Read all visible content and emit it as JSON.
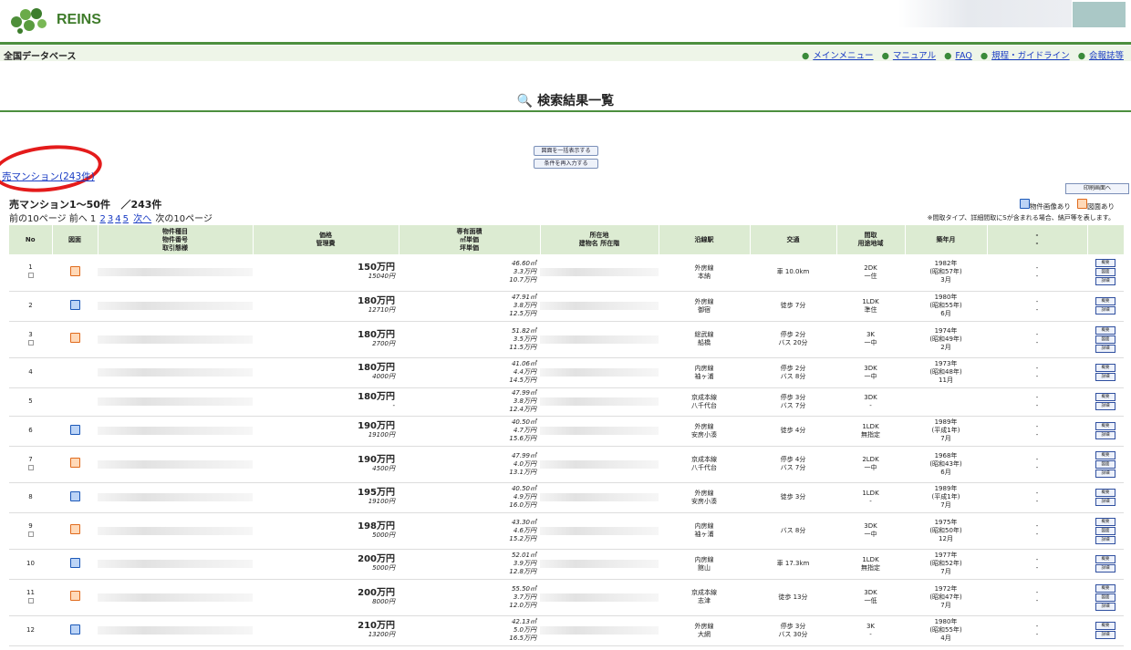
{
  "app": {
    "name": "REINS"
  },
  "nav": {
    "title": "全国データベース",
    "links": [
      "メインメニュー",
      "マニュアル",
      "FAQ",
      "規程・ガイドライン",
      "会報誌等"
    ]
  },
  "page_title": "検索結果一覧",
  "buttons": {
    "zumen_batch": "図面を一括表示する",
    "re_enter": "条件を再入力する",
    "print": "印刷画面へ"
  },
  "category_link": "売マンション(243件)",
  "count_line": {
    "range": "売マンション1～50件",
    "total": "／243件"
  },
  "pager": {
    "prev10": "前の10ページ",
    "prev": "前へ",
    "current": "1",
    "pages": [
      "2",
      "3",
      "4",
      "5"
    ],
    "next": "次へ",
    "next10": "次の10ページ"
  },
  "legend": {
    "photo": "物件画像あり",
    "drawing": "図面あり"
  },
  "note": "※間取タイプ、詳細間取にSが含まれる場合、納戸等を表します。",
  "table": {
    "headers": {
      "no": "No",
      "zumen": "図面",
      "item": [
        "物件種目",
        "物件番号",
        "取引態様"
      ],
      "price": [
        "価格",
        "管理費"
      ],
      "area": [
        "専有面積",
        "㎡単価",
        "坪単価"
      ],
      "loc": [
        "所在地",
        "建物名 所在階"
      ],
      "line": "沿線駅",
      "transit": "交通",
      "layout": [
        "間取",
        "用途地域"
      ],
      "built": "築年月",
      "extra": [
        "-",
        "-"
      ]
    },
    "row_buttons": {
      "detail": "概要",
      "zumen": "図面",
      "more": "詳細"
    },
    "rows": [
      {
        "no": "1",
        "cb": true,
        "icon": "orange",
        "price": "150万円",
        "fee": "15040円",
        "area": "46.60㎡",
        "sqm": "3.3万円",
        "tsubo": "10.7万円",
        "line": "外房線",
        "station": "本納",
        "t1": "車 10.0km",
        "t2": "",
        "layout": "2DK",
        "zone": "一住",
        "y1": "1982年",
        "y2": "(昭和57年)",
        "y3": "3月",
        "btns": [
          "detail",
          "zumen",
          "more"
        ]
      },
      {
        "no": "2",
        "cb": false,
        "icon": "blue",
        "price": "180万円",
        "fee": "12710円",
        "area": "47.91㎡",
        "sqm": "3.8万円",
        "tsubo": "12.5万円",
        "line": "外房線",
        "station": "御宿",
        "t1": "徒歩 7分",
        "t2": "",
        "layout": "1LDK",
        "zone": "準住",
        "y1": "1980年",
        "y2": "(昭和55年)",
        "y3": "6月",
        "btns": [
          "detail",
          "more"
        ]
      },
      {
        "no": "3",
        "cb": true,
        "icon": "orange",
        "price": "180万円",
        "fee": "2700円",
        "area": "51.82㎡",
        "sqm": "3.5万円",
        "tsubo": "11.5万円",
        "line": "総武線",
        "station": "船橋",
        "t1": "停歩 2分",
        "t2": "バス 20分",
        "layout": "3K",
        "zone": "一中",
        "y1": "1974年",
        "y2": "(昭和49年)",
        "y3": "2月",
        "btns": [
          "detail",
          "zumen",
          "more"
        ]
      },
      {
        "no": "4",
        "cb": false,
        "icon": "",
        "price": "180万円",
        "fee": "4000円",
        "area": "41.06㎡",
        "sqm": "4.4万円",
        "tsubo": "14.5万円",
        "line": "内房線",
        "station": "袖ヶ浦",
        "t1": "停歩 2分",
        "t2": "バス 8分",
        "layout": "3DK",
        "zone": "一中",
        "y1": "1973年",
        "y2": "(昭和48年)",
        "y3": "11月",
        "btns": [
          "detail",
          "more"
        ]
      },
      {
        "no": "5",
        "cb": false,
        "icon": "",
        "price": "180万円",
        "fee": "-",
        "area": "47.99㎡",
        "sqm": "3.8万円",
        "tsubo": "12.4万円",
        "line": "京成本線",
        "station": "八千代台",
        "t1": "停歩 3分",
        "t2": "バス 7分",
        "layout": "3DK",
        "zone": "-",
        "y1": "",
        "y2": "",
        "y3": "",
        "btns": [
          "detail",
          "more"
        ]
      },
      {
        "no": "6",
        "cb": false,
        "icon": "blue",
        "price": "190万円",
        "fee": "19100円",
        "area": "40.50㎡",
        "sqm": "4.7万円",
        "tsubo": "15.6万円",
        "line": "外房線",
        "station": "安房小湊",
        "t1": "徒歩 4分",
        "t2": "",
        "layout": "1LDK",
        "zone": "無指定",
        "y1": "1989年",
        "y2": "(平成1年)",
        "y3": "7月",
        "btns": [
          "detail",
          "more"
        ]
      },
      {
        "no": "7",
        "cb": true,
        "icon": "orange",
        "price": "190万円",
        "fee": "4500円",
        "area": "47.99㎡",
        "sqm": "4.0万円",
        "tsubo": "13.1万円",
        "line": "京成本線",
        "station": "八千代台",
        "t1": "停歩 4分",
        "t2": "バス 7分",
        "layout": "2LDK",
        "zone": "一中",
        "y1": "1968年",
        "y2": "(昭和43年)",
        "y3": "6月",
        "btns": [
          "detail",
          "zumen",
          "more"
        ]
      },
      {
        "no": "8",
        "cb": false,
        "icon": "blue",
        "price": "195万円",
        "fee": "19100円",
        "area": "40.50㎡",
        "sqm": "4.9万円",
        "tsubo": "16.0万円",
        "line": "外房線",
        "station": "安房小湊",
        "t1": "徒歩 3分",
        "t2": "",
        "layout": "1LDK",
        "zone": "-",
        "y1": "1989年",
        "y2": "(平成1年)",
        "y3": "7月",
        "btns": [
          "detail",
          "more"
        ]
      },
      {
        "no": "9",
        "cb": true,
        "icon": "orange",
        "price": "198万円",
        "fee": "5000円",
        "area": "43.30㎡",
        "sqm": "4.6万円",
        "tsubo": "15.2万円",
        "line": "内房線",
        "station": "袖ヶ浦",
        "t1": "バス 8分",
        "t2": "",
        "layout": "3DK",
        "zone": "一中",
        "y1": "1975年",
        "y2": "(昭和50年)",
        "y3": "12月",
        "btns": [
          "detail",
          "zumen",
          "more"
        ]
      },
      {
        "no": "10",
        "cb": false,
        "icon": "blue",
        "price": "200万円",
        "fee": "5000円",
        "area": "52.01㎡",
        "sqm": "3.9万円",
        "tsubo": "12.8万円",
        "line": "内房線",
        "station": "館山",
        "t1": "車 17.3km",
        "t2": "",
        "layout": "1LDK",
        "zone": "無指定",
        "y1": "1977年",
        "y2": "(昭和52年)",
        "y3": "7月",
        "btns": [
          "detail",
          "more"
        ]
      },
      {
        "no": "11",
        "cb": true,
        "icon": "orange",
        "price": "200万円",
        "fee": "8000円",
        "area": "55.50㎡",
        "sqm": "3.7万円",
        "tsubo": "12.0万円",
        "line": "京成本線",
        "station": "志津",
        "t1": "徒歩 13分",
        "t2": "",
        "layout": "3DK",
        "zone": "一低",
        "y1": "1972年",
        "y2": "(昭和47年)",
        "y3": "7月",
        "btns": [
          "detail",
          "zumen",
          "more"
        ]
      },
      {
        "no": "12",
        "cb": false,
        "icon": "blue",
        "price": "210万円",
        "fee": "13200円",
        "area": "42.13㎡",
        "sqm": "5.0万円",
        "tsubo": "16.5万円",
        "line": "外房線",
        "station": "大網",
        "t1": "停歩 3分",
        "t2": "バス 30分",
        "layout": "3K",
        "zone": "-",
        "y1": "1980年",
        "y2": "(昭和55年)",
        "y3": "4月",
        "btns": [
          "detail",
          "more"
        ]
      }
    ]
  }
}
